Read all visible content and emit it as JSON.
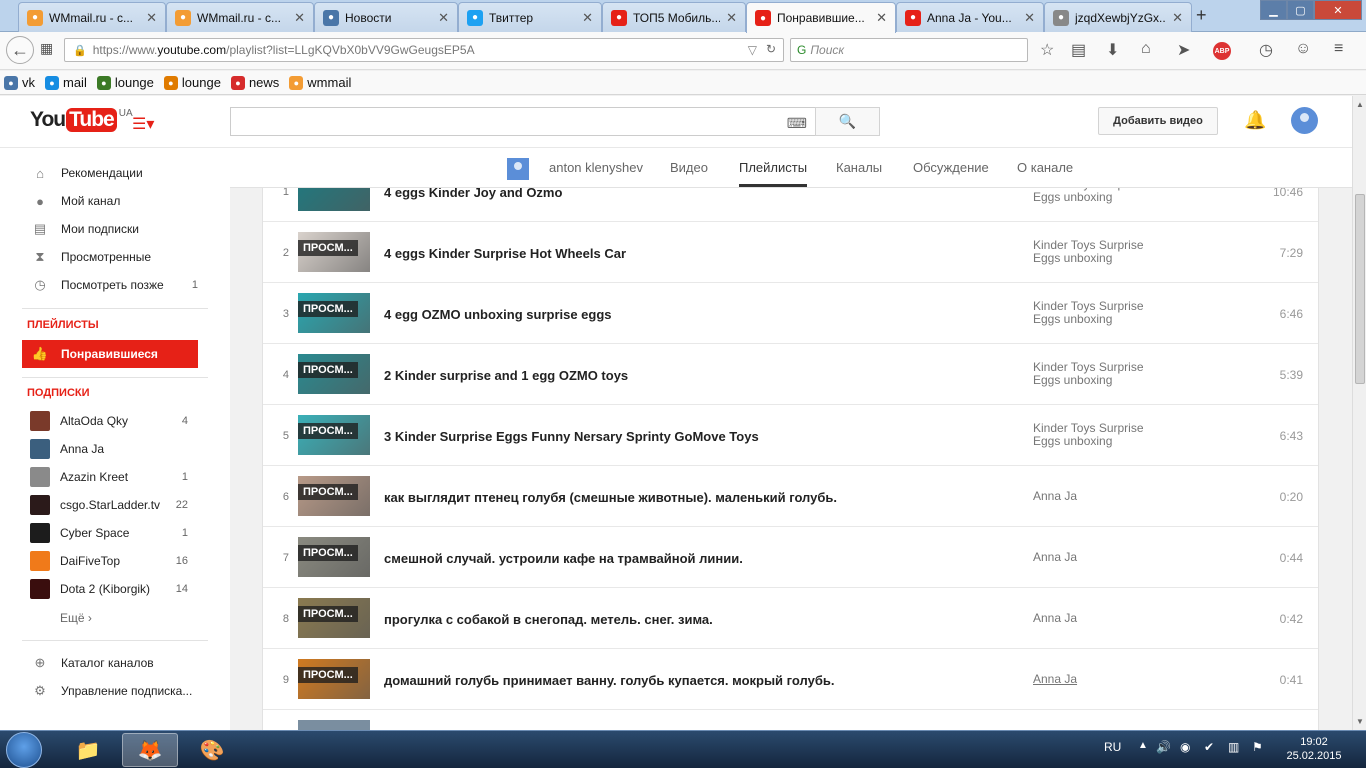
{
  "browser": {
    "tabs": [
      {
        "title": "WMmail.ru - с...",
        "icon": "wmmail-icon",
        "color": "#f39c34"
      },
      {
        "title": "WMmail.ru - с...",
        "icon": "wmmail-icon",
        "color": "#f39c34"
      },
      {
        "title": "Новости",
        "icon": "vk-icon",
        "color": "#4a76a8"
      },
      {
        "title": "Твиттер",
        "icon": "twitter-icon",
        "color": "#1da1f2"
      },
      {
        "title": "ТОП5 Мобиль...",
        "icon": "youtube-icon",
        "color": "#e62117"
      },
      {
        "title": "Понравившие...",
        "icon": "youtube-icon",
        "color": "#e62117",
        "active": true
      },
      {
        "title": "Anna Ja - You...",
        "icon": "youtube-icon",
        "color": "#e62117"
      },
      {
        "title": "jzqdXewbjYzGx...",
        "icon": "page-icon",
        "color": "#888888"
      }
    ],
    "url_prefix": "https://www.",
    "url_domain": "youtube.com",
    "url_rest": "/playlist?list=LLgKQVbX0bVV9GwGeugsEP5A",
    "search_placeholder": "Поиск",
    "bookmarks": [
      {
        "label": "vk",
        "color": "#4a76a8"
      },
      {
        "label": "mail",
        "color": "#168de2"
      },
      {
        "label": "lounge",
        "color": "#3c7a26"
      },
      {
        "label": "lounge",
        "color": "#e07b00"
      },
      {
        "label": "news",
        "color": "#d62b2b"
      },
      {
        "label": "wmmail",
        "color": "#f39c34"
      }
    ]
  },
  "youtube": {
    "logo_you": "You",
    "logo_tube": "Tube",
    "logo_region": "UA",
    "upload_label": "Добавить видео",
    "channel_tabs": {
      "name": "anton klenyshev",
      "videos": "Видео",
      "playlists": "Плейлисты",
      "channels": "Каналы",
      "discussion": "Обсуждение",
      "about": "О канале"
    },
    "guide": {
      "main": [
        {
          "label": "Рекомендации",
          "icon": "home-icon",
          "count": ""
        },
        {
          "label": "Мой канал",
          "icon": "user-circle-icon",
          "count": ""
        },
        {
          "label": "Мои подписки",
          "icon": "subscriptions-icon",
          "count": ""
        },
        {
          "label": "Просмотренные",
          "icon": "hourglass-icon",
          "count": ""
        },
        {
          "label": "Посмотреть позже",
          "icon": "clock-icon",
          "count": "1"
        }
      ],
      "playlists_header": "ПЛЕЙЛИСТЫ",
      "liked_label": "Понравившиеся",
      "subs_header": "ПОДПИСКИ",
      "subscriptions": [
        {
          "label": "AltaOda Qky",
          "count": "4",
          "color": "#7a3a2a"
        },
        {
          "label": "Anna Ja",
          "count": "",
          "color": "#3b5f7e"
        },
        {
          "label": "Azazin Kreet",
          "count": "1",
          "color": "#8a8a8a"
        },
        {
          "label": "csgo.StarLadder.tv",
          "count": "22",
          "color": "#2b1a1a"
        },
        {
          "label": "Cyber Space",
          "count": "1",
          "color": "#1c1c1c"
        },
        {
          "label": "DaiFiveTop",
          "count": "16",
          "color": "#f07a1a"
        },
        {
          "label": "Dota 2 (Kiborgik)",
          "count": "14",
          "color": "#3a0e0e"
        }
      ],
      "more_label": "Ещё ›",
      "catalog_label": "Каталог каналов",
      "manage_label": "Управление подписка..."
    },
    "videos": [
      {
        "index": "1",
        "title": "4 eggs Kinder Joy and Ozmo",
        "owner": "Kinder Toys Surprise Eggs unboxing",
        "duration": "10:46",
        "overlay": "",
        "thumb": "#1f7a80"
      },
      {
        "index": "2",
        "title": "4 eggs Kinder Surprise Hot Wheels Car",
        "owner": "Kinder Toys Surprise Eggs unboxing",
        "duration": "7:29",
        "overlay": "ПРОСМ...",
        "thumb": "#d9d2cc"
      },
      {
        "index": "3",
        "title": "4 egg OZMO unboxing surprise eggs",
        "owner": "Kinder Toys Surprise Eggs unboxing",
        "duration": "6:46",
        "overlay": "ПРОСМ...",
        "thumb": "#2aa7b0"
      },
      {
        "index": "4",
        "title": "2 Kinder surprise and 1 egg OZMO toys",
        "owner": "Kinder Toys Surprise Eggs unboxing",
        "duration": "5:39",
        "overlay": "ПРОСМ...",
        "thumb": "#2a8a90"
      },
      {
        "index": "5",
        "title": "3 Kinder Surprise Eggs Funny Nersary Sprinty GoMove Toys",
        "owner": "Kinder Toys Surprise Eggs unboxing",
        "duration": "6:43",
        "overlay": "ПРОСМ...",
        "thumb": "#3ab0b8"
      },
      {
        "index": "6",
        "title": "как выглядит птенец голубя (смешные животные). маленький голубь.",
        "owner": "Anna Ja",
        "duration": "0:20",
        "overlay": "ПРОСМ...",
        "thumb": "#b89a88"
      },
      {
        "index": "7",
        "title": "смешной случай. устроили кафе на трамвайной линии.",
        "owner": "Anna Ja",
        "duration": "0:44",
        "overlay": "ПРОСМ...",
        "thumb": "#8a8a80"
      },
      {
        "index": "8",
        "title": "прогулка с собакой в снегопад. метель. снег. зима.",
        "owner": "Anna Ja",
        "duration": "0:42",
        "overlay": "ПРОСМ...",
        "thumb": "#8a7a50"
      },
      {
        "index": "9",
        "title": "домашний голубь принимает ванну. голубь купается. мокрый голубь.",
        "owner": "Anna Ja",
        "duration": "0:41",
        "overlay": "ПРОСМ...",
        "thumb": "#d07a20",
        "owner_underlined": true
      }
    ]
  },
  "taskbar": {
    "lang": "RU",
    "time": "19:02",
    "date": "25.02.2015"
  }
}
